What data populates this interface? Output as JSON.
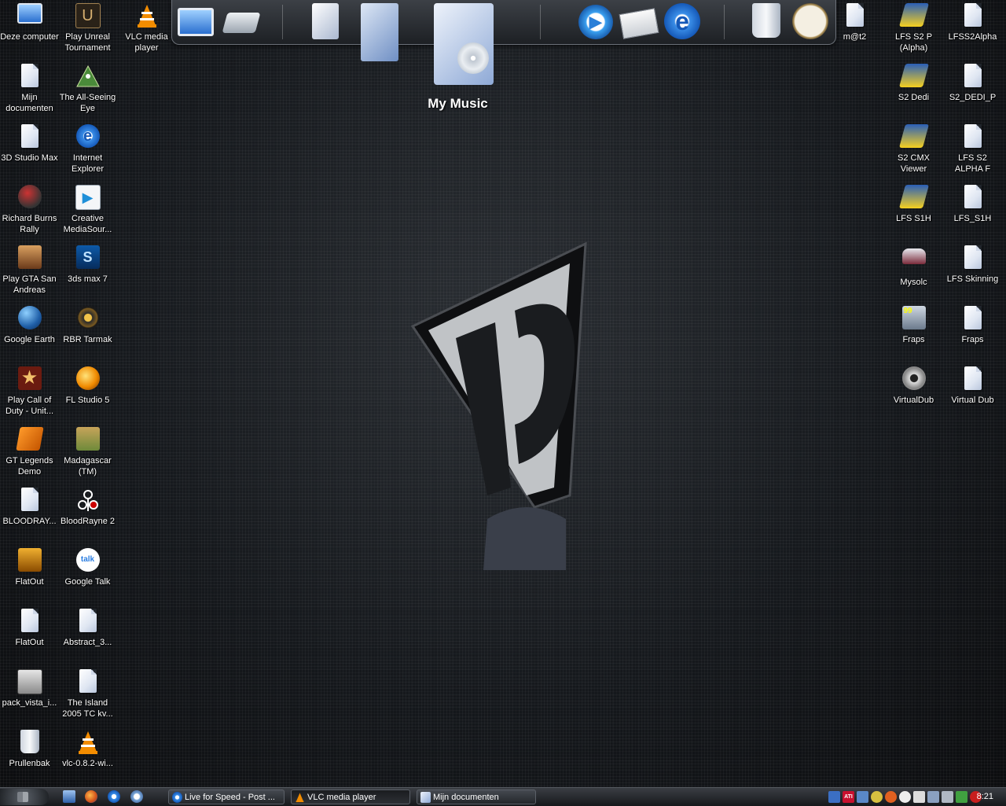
{
  "desktop": {
    "icons_left_col1": [
      {
        "label": "Deze computer",
        "icon": "my-computer-icon"
      },
      {
        "label": "Mijn documenten",
        "icon": "documents-icon"
      },
      {
        "label": "3D Studio Max",
        "icon": "file-icon"
      },
      {
        "label": "Richard Burns Rally",
        "icon": "helmet-icon"
      },
      {
        "label": "Play GTA San Andreas",
        "icon": "gta-icon"
      },
      {
        "label": "Google Earth",
        "icon": "globe-icon"
      },
      {
        "label": "Play  Call of Duty - Unit...",
        "icon": "star-icon"
      },
      {
        "label": "GT Legends Demo",
        "icon": "gt-legends-icon"
      },
      {
        "label": "BLOODRAY...",
        "icon": "file-icon"
      },
      {
        "label": "FlatOut",
        "icon": "flatout-icon"
      },
      {
        "label": "FlatOut",
        "icon": "file-icon"
      },
      {
        "label": "pack_vista_i...",
        "icon": "package-icon"
      },
      {
        "label": "Prullenbak",
        "icon": "recycle-bin-icon"
      }
    ],
    "icons_left_col2": [
      {
        "label": "Play Unreal Tournament",
        "icon": "unreal-icon"
      },
      {
        "label": "The All-Seeing Eye",
        "icon": "eye-pyramid-icon"
      },
      {
        "label": "Internet Explorer",
        "icon": "ie-icon"
      },
      {
        "label": "Creative MediaSour...",
        "icon": "media-player-icon"
      },
      {
        "label": "3ds max 7",
        "icon": "3ds-max-icon"
      },
      {
        "label": "RBR Tarmak",
        "icon": "wheel-icon"
      },
      {
        "label": "FL Studio 5",
        "icon": "fruity-icon"
      },
      {
        "label": "Madagascar (TM)",
        "icon": "madagascar-icon"
      },
      {
        "label": "BloodRayne 2",
        "icon": "bloodrayne-icon"
      },
      {
        "label": "Google Talk",
        "icon": "talk-icon"
      },
      {
        "label": "Abstract_3...",
        "icon": "file-icon"
      },
      {
        "label": "The Island 2005 TC kv...",
        "icon": "file-icon"
      },
      {
        "label": "vlc-0.8.2-wi...",
        "icon": "vlc-icon"
      }
    ],
    "icons_vlc": {
      "label": "VLC media player",
      "icon": "vlc-icon"
    },
    "icons_right": [
      {
        "label": "m@t2",
        "icon": "file-icon"
      },
      {
        "label": "LFS S2 P (Alpha)",
        "icon": "lfs-icon"
      },
      {
        "label": "LFSS2Alpha",
        "icon": "file-icon"
      },
      {
        "label": "S2 Dedi",
        "icon": "lfs-icon"
      },
      {
        "label": "S2_DEDI_P",
        "icon": "file-icon"
      },
      {
        "label": "S2 CMX Viewer",
        "icon": "lfs-icon"
      },
      {
        "label": "LFS S2 ALPHA F",
        "icon": "file-icon"
      },
      {
        "label": "LFS S1H",
        "icon": "lfs-icon"
      },
      {
        "label": "LFS_S1H",
        "icon": "file-icon"
      },
      {
        "label": "Mysolc",
        "icon": "car-icon"
      },
      {
        "label": "LFS Skinning",
        "icon": "file-icon"
      },
      {
        "label": "Fraps",
        "icon": "fraps-icon"
      },
      {
        "label": "Fraps",
        "icon": "file-icon"
      },
      {
        "label": "VirtualDub",
        "icon": "gear-icon"
      },
      {
        "label": "Virtual Dub",
        "icon": "file-icon"
      }
    ]
  },
  "dock": {
    "hover_label": "My Music",
    "items": [
      "computer-icon",
      "scanner-icon",
      "documents-icon",
      "pictures-icon",
      "music-folder-icon",
      "media-player-icon",
      "mail-icon",
      "ie-icon",
      "recycle-bin-icon",
      "clock-icon"
    ]
  },
  "taskbar": {
    "tasks": [
      {
        "label": "Live for Speed - Post ...",
        "icon": "ie-icon"
      },
      {
        "label": "VLC media player",
        "icon": "vlc-icon"
      },
      {
        "label": "Mijn documenten",
        "icon": "folder-icon"
      }
    ],
    "tray_labels": {
      "ati": "ATI"
    },
    "clock": "8:21"
  },
  "colors": {
    "accent": "#3a7bd5",
    "vlc_orange": "#f28c00",
    "text": "#ffffff"
  }
}
